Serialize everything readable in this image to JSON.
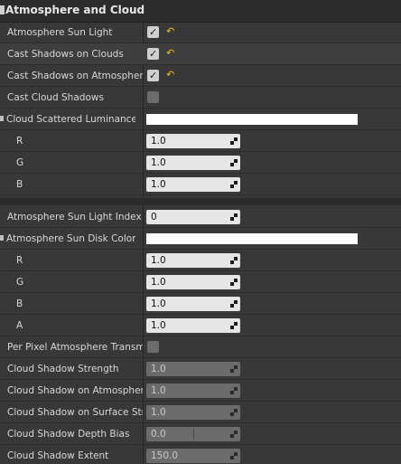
{
  "section": {
    "title": "Atmosphere and Cloud"
  },
  "rows": {
    "atmosphere_sun_light": {
      "label": "Atmosphere Sun Light",
      "checked": true,
      "reset_icon": "reset-arrow-icon"
    },
    "cast_shadows_on_clouds": {
      "label": "Cast Shadows on Clouds",
      "checked": true,
      "reset_icon": "reset-arrow-icon"
    },
    "cast_shadows_on_atmosphere": {
      "label": "Cast Shadows on Atmosphere",
      "checked": true,
      "reset_icon": "reset-arrow-icon"
    },
    "cast_cloud_shadows": {
      "label": "Cast Cloud Shadows",
      "checked": false
    },
    "cloud_scattered_luminance_scale": {
      "label": "Cloud Scattered Luminance S",
      "color": "#ffffff"
    },
    "cloud_r": {
      "label": "R",
      "value": "1.0"
    },
    "cloud_g": {
      "label": "G",
      "value": "1.0"
    },
    "cloud_b": {
      "label": "B",
      "value": "1.0"
    },
    "atmosphere_sun_light_index": {
      "label": "Atmosphere Sun Light Index",
      "value": "0"
    },
    "atmosphere_sun_disk_color_scale": {
      "label": "Atmosphere Sun Disk Color S",
      "color": "#ffffff"
    },
    "disk_r": {
      "label": "R",
      "value": "1.0"
    },
    "disk_g": {
      "label": "G",
      "value": "1.0"
    },
    "disk_b": {
      "label": "B",
      "value": "1.0"
    },
    "disk_a": {
      "label": "A",
      "value": "1.0"
    },
    "per_pixel_atmosphere_transmittance": {
      "label": "Per Pixel Atmosphere Transm",
      "checked": false
    },
    "cloud_shadow_strength": {
      "label": "Cloud Shadow Strength",
      "value": "1.0",
      "enabled": false
    },
    "cloud_shadow_on_atmosphere_strength": {
      "label": "Cloud Shadow on Atmosphere",
      "value": "1.0",
      "enabled": false
    },
    "cloud_shadow_on_surface_strength": {
      "label": "Cloud Shadow on Surface Stre",
      "value": "1.0",
      "enabled": false
    },
    "cloud_shadow_depth_bias": {
      "label": "Cloud Shadow Depth Bias",
      "value": "0.0",
      "enabled": false
    },
    "cloud_shadow_extent": {
      "label": "Cloud Shadow Extent",
      "value": "150.0",
      "enabled": false
    }
  },
  "colors": {
    "panel_bg": "#383838",
    "reset_arrow": "#e6c21a",
    "field_bg": "#e5e5e5",
    "disabled_field_bg": "#6b6b6b"
  }
}
